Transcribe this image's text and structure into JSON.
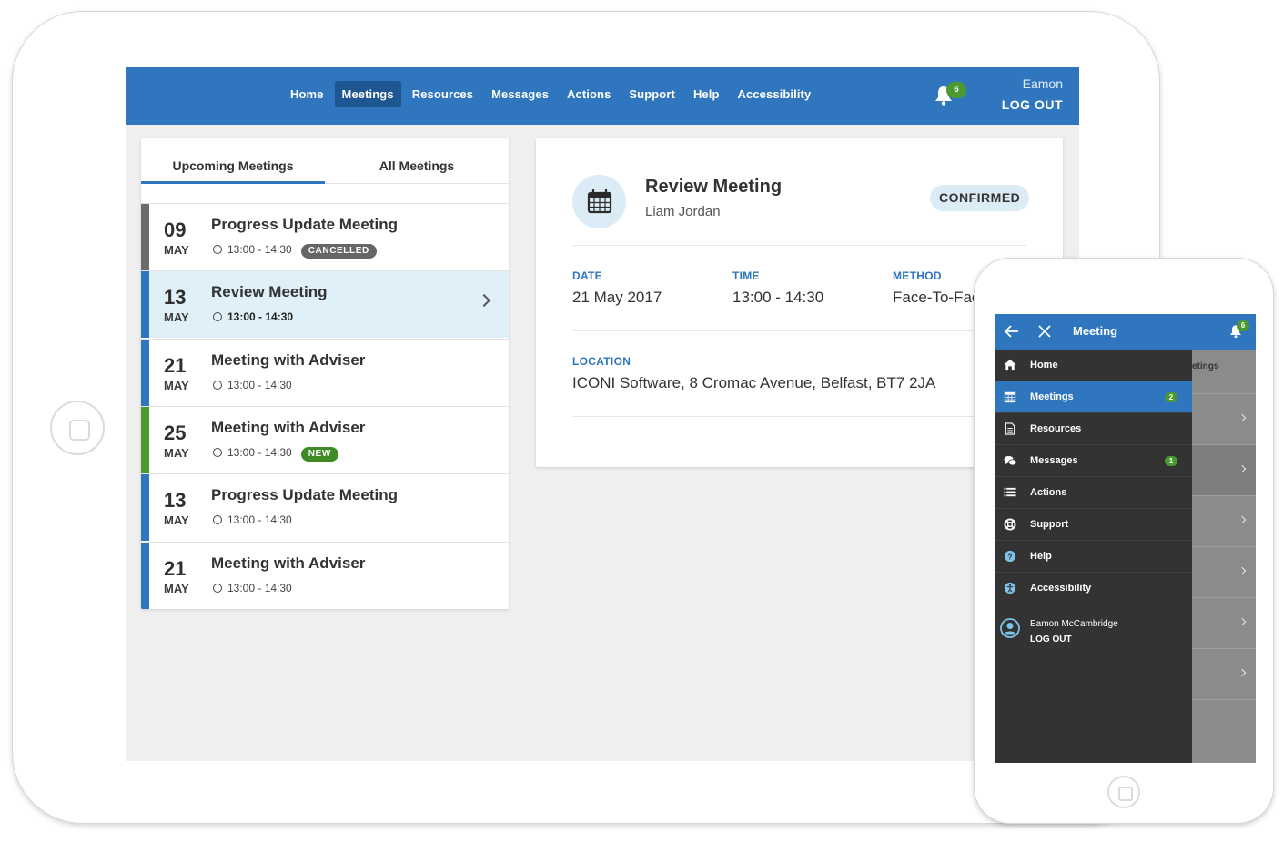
{
  "nav": {
    "items": [
      {
        "label": "Home"
      },
      {
        "label": "Meetings",
        "active": true
      },
      {
        "label": "Resources"
      },
      {
        "label": "Messages"
      },
      {
        "label": "Actions"
      },
      {
        "label": "Support"
      },
      {
        "label": "Help"
      },
      {
        "label": "Accessibility"
      }
    ],
    "notification_count": "6",
    "user_name": "Eamon",
    "logout_label": "LOG OUT"
  },
  "tabs": {
    "upcoming": "Upcoming Meetings",
    "all": "All Meetings"
  },
  "meetings": [
    {
      "day": "09",
      "month": "MAY",
      "title": "Progress Update Meeting",
      "time": "13:00 - 14:30",
      "badge": "CANCELLED",
      "badge_color": "#666666",
      "stripe": "#6b6b6b"
    },
    {
      "day": "13",
      "month": "MAY",
      "title": "Review Meeting",
      "time": "13:00 - 14:30",
      "badge": "",
      "stripe": "#2f76be",
      "selected": true
    },
    {
      "day": "21",
      "month": "MAY",
      "title": "Meeting with Adviser",
      "time": "13:00 - 14:30",
      "badge": "",
      "stripe": "#2f76be"
    },
    {
      "day": "25",
      "month": "MAY",
      "title": "Meeting with Adviser",
      "time": "13:00 - 14:30",
      "badge": "NEW",
      "badge_color": "#3d8a26",
      "stripe": "#4a9a2f"
    },
    {
      "day": "13",
      "month": "MAY",
      "title": "Progress Update Meeting",
      "time": "13:00 - 14:30",
      "badge": "",
      "stripe": "#2f76be"
    },
    {
      "day": "21",
      "month": "MAY",
      "title": "Meeting with Adviser",
      "time": "13:00 - 14:30",
      "badge": "",
      "stripe": "#2f76be"
    }
  ],
  "detail": {
    "title": "Review Meeting",
    "attendee": "Liam Jordan",
    "status": "CONFIRMED",
    "date_label": "DATE",
    "date": "21 May 2017",
    "time_label": "TIME",
    "time": "13:00 - 14:30",
    "method_label": "METHOD",
    "method": "Face-To-Face",
    "location_label": "LOCATION",
    "location": "ICONI Software, 8 Cromac Avenue, Belfast, BT7 2JA"
  },
  "mobile": {
    "header_title": "Meeting",
    "notification_count": "6",
    "background_tab_fragment": "etings",
    "menu": [
      {
        "label": "Home",
        "icon": "home-icon"
      },
      {
        "label": "Meetings",
        "icon": "calendar-icon",
        "badge": "2",
        "active": true
      },
      {
        "label": "Resources",
        "icon": "document-icon"
      },
      {
        "label": "Messages",
        "icon": "chat-icon",
        "badge": "1"
      },
      {
        "label": "Actions",
        "icon": "list-icon"
      },
      {
        "label": "Support",
        "icon": "lifebuoy-icon"
      },
      {
        "label": "Help",
        "icon": "help-icon"
      },
      {
        "label": "Accessibility",
        "icon": "accessibility-icon"
      }
    ],
    "user_name": "Eamon McCambridge",
    "logout_label": "LOG OUT"
  },
  "colors": {
    "brand_blue": "#2f76be",
    "nav_active": "#1d5690",
    "badge_green": "#4a9a2f",
    "drawer_bg": "#333333"
  }
}
